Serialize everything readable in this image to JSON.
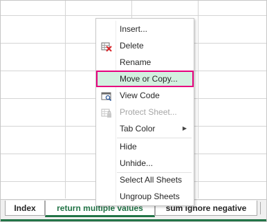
{
  "context_menu": {
    "items": [
      {
        "id": "insert",
        "label": "Insert...",
        "enabled": true
      },
      {
        "id": "delete",
        "label": "Delete",
        "enabled": true,
        "icon": "delete-sheet-icon"
      },
      {
        "id": "rename",
        "label": "Rename",
        "enabled": true
      },
      {
        "id": "move_or_copy",
        "label": "Move or Copy...",
        "enabled": true,
        "highlighted": true
      },
      {
        "id": "view_code",
        "label": "View Code",
        "enabled": true,
        "icon": "view-code-icon"
      },
      {
        "id": "protect_sheet",
        "label": "Protect Sheet...",
        "enabled": false,
        "icon": "protect-sheet-icon"
      },
      {
        "id": "tab_color",
        "label": "Tab Color",
        "enabled": true,
        "submenu": true
      },
      {
        "id": "hide",
        "label": "Hide",
        "enabled": true
      },
      {
        "id": "unhide",
        "label": "Unhide...",
        "enabled": true
      },
      {
        "id": "select_all",
        "label": "Select All Sheets",
        "enabled": true
      },
      {
        "id": "ungroup",
        "label": "Ungroup Sheets",
        "enabled": true
      }
    ],
    "highlight_color": "#d3f0e0",
    "callout_border_color": "#e6007e"
  },
  "sheet_tabs": {
    "tabs": [
      {
        "label": "Index",
        "active": false
      },
      {
        "label": "return multiple values",
        "active": true
      },
      {
        "label": "sum ignore negative",
        "active": false
      }
    ],
    "active_color": "#217346"
  }
}
